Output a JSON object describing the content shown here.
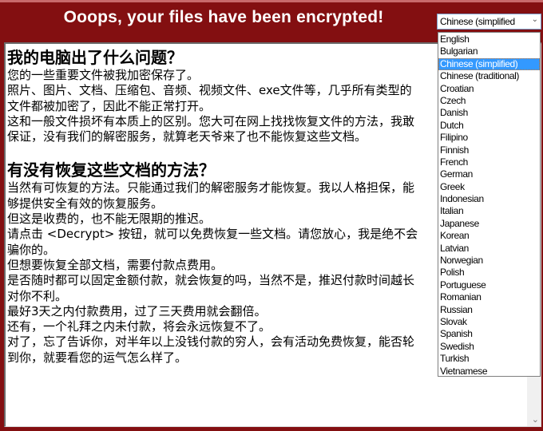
{
  "window": {
    "title": "Ooops, your files have been encrypted!"
  },
  "language_select": {
    "selected": "Chinese (simplified",
    "options": [
      "English",
      "Bulgarian",
      "Chinese (simplified)",
      "Chinese (traditional)",
      "Croatian",
      "Czech",
      "Danish",
      "Dutch",
      "Filipino",
      "Finnish",
      "French",
      "German",
      "Greek",
      "Indonesian",
      "Italian",
      "Japanese",
      "Korean",
      "Latvian",
      "Norwegian",
      "Polish",
      "Portuguese",
      "Romanian",
      "Russian",
      "Slovak",
      "Spanish",
      "Swedish",
      "Turkish",
      "Vietnamese"
    ],
    "selected_index": 2
  },
  "message": {
    "section1": {
      "heading": "我的电脑出了什么问题？",
      "lines": [
        "您的一些重要文件被我加密保存了。",
        "照片、图片、文档、压缩包、音频、视频文件、exe文件等，几乎所有类型的",
        "文件都被加密了，因此不能正常打开。",
        "这和一般文件损坏有本质上的区别。您大可在网上找找恢复文件的方法，我敢",
        "保证，没有我们的解密服务，就算老天爷来了也不能恢复这些文档。"
      ]
    },
    "section2": {
      "heading": "有没有恢复这些文档的方法？",
      "lines": [
        "当然有可恢复的方法。只能通过我们的解密服务才能恢复。我以人格担保，能",
        "够提供安全有效的恢复服务。",
        "但这是收费的，也不能无限期的推迟。",
        "请点击 <Decrypt> 按钮，就可以免费恢复一些文档。请您放心，我是绝不会",
        "骗你的。",
        "但想要恢复全部文档，需要付款点费用。",
        "是否随时都可以固定金额付款，就会恢复的吗，当然不是，推迟付款时间越长",
        "对你不利。",
        "最好3天之内付款费用，过了三天费用就会翻倍。",
        "还有，一个礼拜之内未付款，将会永远恢复不了。",
        "对了，忘了告诉你，对半年以上没钱付款的穷人，会有活动免费恢复，能否轮",
        "到你，就要看您的运气怎么样了。"
      ]
    }
  },
  "icons": {
    "dropdown_chevron": "⌄",
    "scroll_down": "⌄"
  },
  "colors": {
    "background": "#830f11",
    "selection": "#3399ff"
  }
}
